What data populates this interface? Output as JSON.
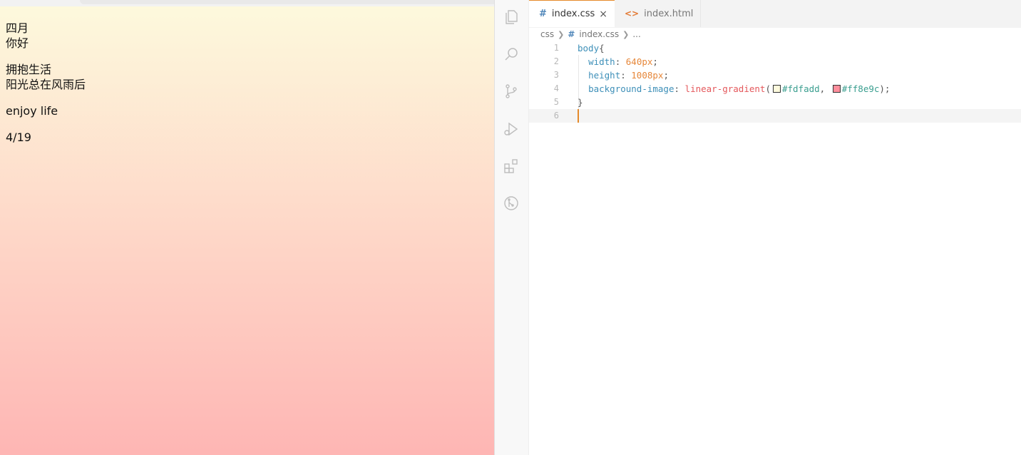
{
  "preview": {
    "lines": [
      [
        "四月",
        "你好"
      ],
      [
        "拥抱生活",
        "阳光总在风雨后"
      ],
      [
        "enjoy life"
      ],
      [
        "4/19"
      ]
    ],
    "gradient": {
      "from": "#fdfadd",
      "to": "#ff8e9c"
    }
  },
  "editor": {
    "activity_icons": [
      "explorer-icon",
      "search-icon",
      "source-control-icon",
      "run-debug-icon",
      "extensions-icon",
      "git-graph-icon"
    ],
    "tabs": [
      {
        "label": "index.css",
        "icon": "#",
        "active": true,
        "close": "×"
      },
      {
        "label": "index.html",
        "icon": "<>",
        "active": false
      }
    ],
    "breadcrumb": {
      "folder": "css",
      "file": "index.css",
      "more": "..."
    },
    "line_numbers": [
      "1",
      "2",
      "3",
      "4",
      "5",
      "6"
    ],
    "code": {
      "selector": "body",
      "open_brace": "{",
      "close_brace": "}",
      "width_prop": "width",
      "width_val": "640px",
      "height_prop": "height",
      "height_val": "1008px",
      "bg_prop": "background-image",
      "bg_fn": "linear-gradient",
      "color1": "#fdfadd",
      "color2": "#ff8e9c"
    },
    "accent_color": "#e58a2a"
  }
}
